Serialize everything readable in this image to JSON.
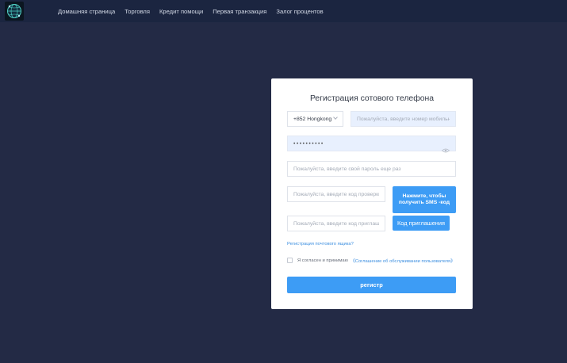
{
  "nav": {
    "items": [
      {
        "label": "Домашняя страница"
      },
      {
        "label": "Торговля"
      },
      {
        "label": "Кредит помощи"
      },
      {
        "label": "Первая транзакция"
      },
      {
        "label": "Залог процентов"
      }
    ]
  },
  "form": {
    "title": "Регистрация сотового телефона",
    "country_code": "+852 Hongkong",
    "phone_placeholder": "Пожалуйста, введите номер мобильного телефона",
    "password_value": "••••••••••",
    "confirm_placeholder": "Пожалуйста, введите свой пароль еще раз",
    "sms_code_placeholder": "Пожалуйста, введите код проверки",
    "sms_button": "Нажмите, чтобы получить SMS -код",
    "invite_placeholder": "Пожалуйста, введите код приглашения",
    "invite_button": "Код приглашения",
    "email_register_link": "Регистрация почтового ящика?",
    "agree_text": "Я согласен и принимаю",
    "agreement_link": "《Соглашение об обслуживании пользователя》",
    "register_button": "регистр"
  },
  "colors": {
    "background": "#232a45",
    "header": "#1b2540",
    "accent": "#3d9cf5",
    "link": "#3d8fe0"
  },
  "icons": {
    "logo": "globe-logo-icon",
    "country_dropdown": "chevron-down-icon",
    "password_toggle": "eye-icon"
  }
}
